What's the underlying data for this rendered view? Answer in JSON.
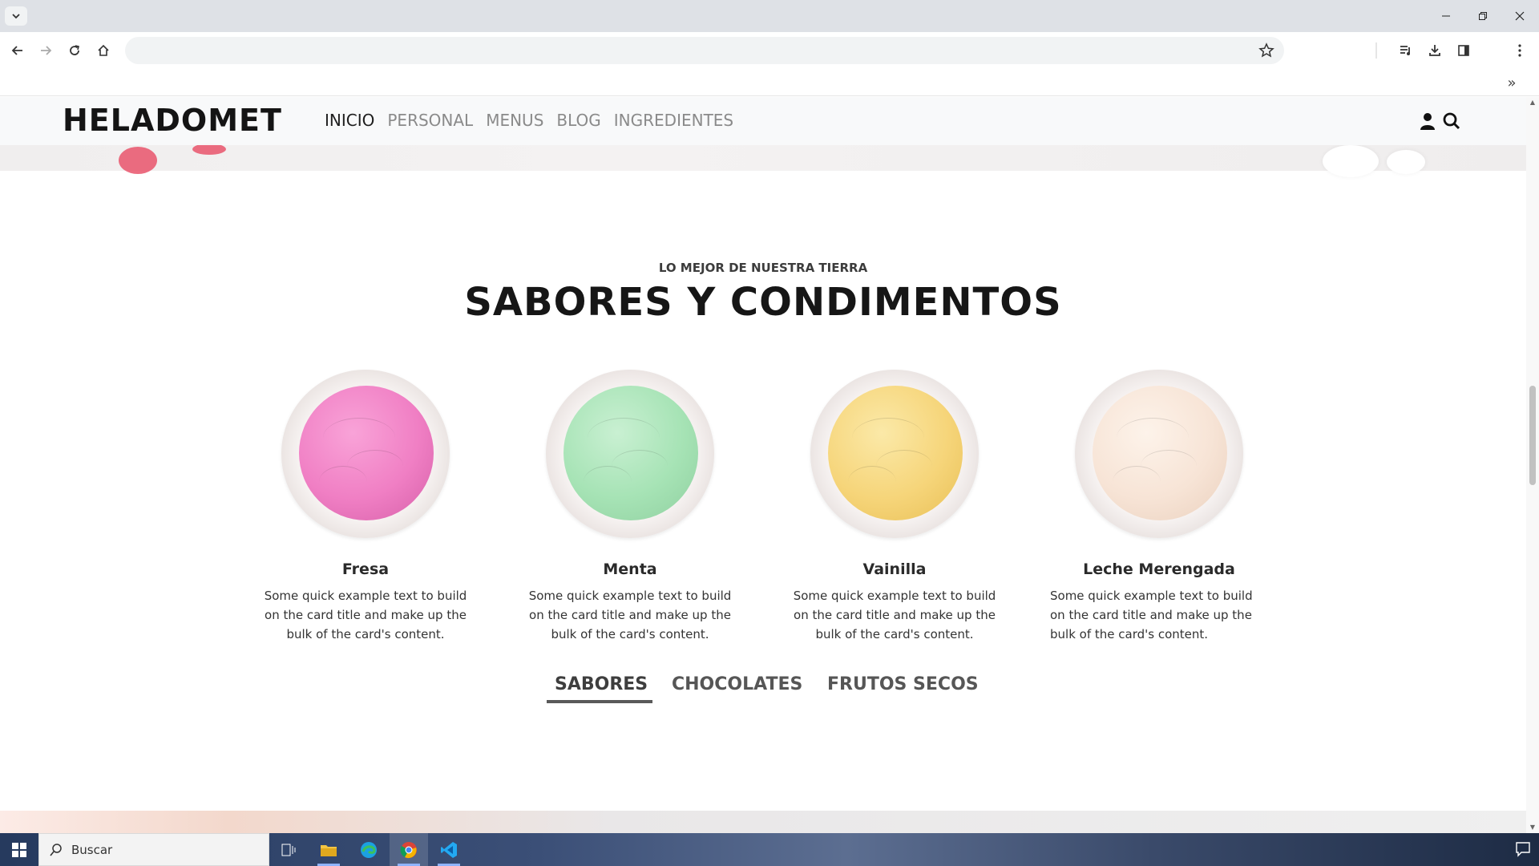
{
  "browser": {
    "omnibox_value": "",
    "omnibox_placeholder": ""
  },
  "site": {
    "brand": "HELADOMET",
    "nav": [
      {
        "label": "INICIO",
        "active": true
      },
      {
        "label": "PERSONAL",
        "active": false
      },
      {
        "label": "MENUS",
        "active": false
      },
      {
        "label": "BLOG",
        "active": false
      },
      {
        "label": "INGREDIENTES",
        "active": false
      }
    ]
  },
  "section": {
    "eyebrow": "LO MEJOR DE NUESTRA TIERRA",
    "title": "SABORES Y CONDIMENTOS"
  },
  "cards": [
    {
      "title": "Fresa",
      "text": "Some quick example text to build on the card title and make up the bulk of the card's content.",
      "color": "#f07fc4"
    },
    {
      "title": "Menta",
      "text": "Some quick example text to build on the card title and make up the bulk of the card's content.",
      "color": "#a6e3b5"
    },
    {
      "title": "Vainilla",
      "text": "Some quick example text to build on the card title and make up the bulk of the card's content.",
      "color": "#f6d57a"
    },
    {
      "title": "Leche Merengada",
      "text": "Some quick example text to build on the card title and make up the bulk of the card's content.",
      "color": "#f7e4d6"
    }
  ],
  "tabs": [
    {
      "label": "SABORES",
      "active": true
    },
    {
      "label": "CHOCOLATES",
      "active": false
    },
    {
      "label": "FRUTOS SECOS",
      "active": false
    }
  ],
  "taskbar": {
    "search_placeholder": "Buscar"
  }
}
